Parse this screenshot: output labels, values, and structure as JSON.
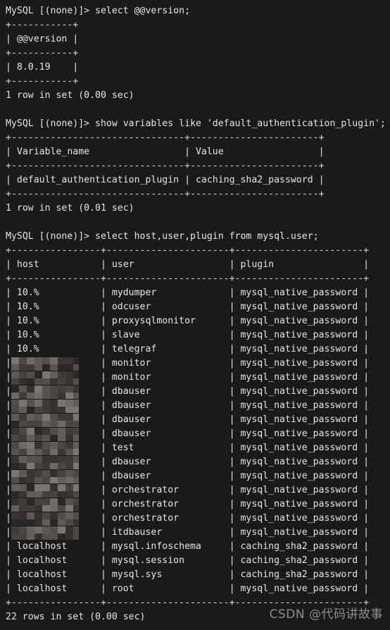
{
  "terminal": {
    "background_color": "#1c1a19",
    "text_color": "#e6e4df",
    "prompt": "MySQL [(none)]> "
  },
  "blocks": [
    {
      "command_line": "MySQL [(none)]> select @@version;",
      "rule_top": "+-----------+",
      "header_line": "| @@version |",
      "rule_mid": "+-----------+",
      "rows": [
        "| 8.0.19    |"
      ],
      "rule_bottom": "+-----------+",
      "status": "1 row in set (0.00 sec)"
    },
    {
      "command_line": "MySQL [(none)]> show variables like 'default_authentication_plugin';",
      "rule_top": "+-------------------------------+-----------------------+",
      "header_line": "| Variable_name                 | Value                 |",
      "rule_mid": "+-------------------------------+-----------------------+",
      "rows": [
        "| default_authentication_plugin | caching_sha2_password |"
      ],
      "rule_bottom": "+-------------------------------+-----------------------+",
      "status": "1 row in set (0.01 sec)"
    }
  ],
  "user_query": {
    "command_line": "MySQL [(none)]> select host,user,plugin from mysql.user;",
    "rule": "+----------------+----------------------+-----------------------+",
    "header_line": "| host           | user                 | plugin                |",
    "status": "22 rows in set (0.00 sec)",
    "columns": [
      "host",
      "user",
      "plugin"
    ],
    "rows": [
      {
        "host": "10.%",
        "redacted": false,
        "user": "mydumper",
        "plugin": "mysql_native_password"
      },
      {
        "host": "10.%",
        "redacted": false,
        "user": "odcuser",
        "plugin": "mysql_native_password"
      },
      {
        "host": "10.%",
        "redacted": false,
        "user": "proxysqlmonitor",
        "plugin": "mysql_native_password"
      },
      {
        "host": "10.%",
        "redacted": false,
        "user": "slave",
        "plugin": "mysql_native_password"
      },
      {
        "host": "10.%",
        "redacted": false,
        "user": "telegraf",
        "plugin": "mysql_native_password"
      },
      {
        "host": "",
        "redacted": true,
        "user": "monitor",
        "plugin": "mysql_native_password"
      },
      {
        "host": "",
        "redacted": true,
        "user": "monitor",
        "plugin": "mysql_native_password"
      },
      {
        "host": "",
        "redacted": true,
        "user": "dbauser",
        "plugin": "mysql_native_password"
      },
      {
        "host": "",
        "redacted": true,
        "user": "dbauser",
        "plugin": "mysql_native_password"
      },
      {
        "host": "",
        "redacted": true,
        "user": "dbauser",
        "plugin": "mysql_native_password"
      },
      {
        "host": "",
        "redacted": true,
        "user": "dbauser",
        "plugin": "mysql_native_password"
      },
      {
        "host": "",
        "redacted": true,
        "user": "test",
        "plugin": "mysql_native_password"
      },
      {
        "host": "",
        "redacted": true,
        "user": "dbauser",
        "plugin": "mysql_native_password"
      },
      {
        "host": "",
        "redacted": true,
        "user": "dbauser",
        "plugin": "mysql_native_password"
      },
      {
        "host": "",
        "redacted": true,
        "user": "orchestrator",
        "plugin": "mysql_native_password"
      },
      {
        "host": "",
        "redacted": true,
        "user": "orchestrator",
        "plugin": "mysql_native_password"
      },
      {
        "host": "",
        "redacted": true,
        "user": "orchestrator",
        "plugin": "mysql_native_password"
      },
      {
        "host": "",
        "redacted": true,
        "user": "itdbauser",
        "plugin": "mysql_native_password"
      },
      {
        "host": "localhost",
        "redacted": false,
        "user": "mysql.infoschema",
        "plugin": "caching_sha2_password"
      },
      {
        "host": "localhost",
        "redacted": false,
        "user": "mysql.session",
        "plugin": "caching_sha2_password"
      },
      {
        "host": "localhost",
        "redacted": false,
        "user": "mysql.sys",
        "plugin": "caching_sha2_password"
      },
      {
        "host": "localhost",
        "redacted": false,
        "user": "root",
        "plugin": "mysql_native_password"
      }
    ]
  },
  "watermark": {
    "text": "CSDN @代码讲故事",
    "color": "#8d8d8d"
  }
}
